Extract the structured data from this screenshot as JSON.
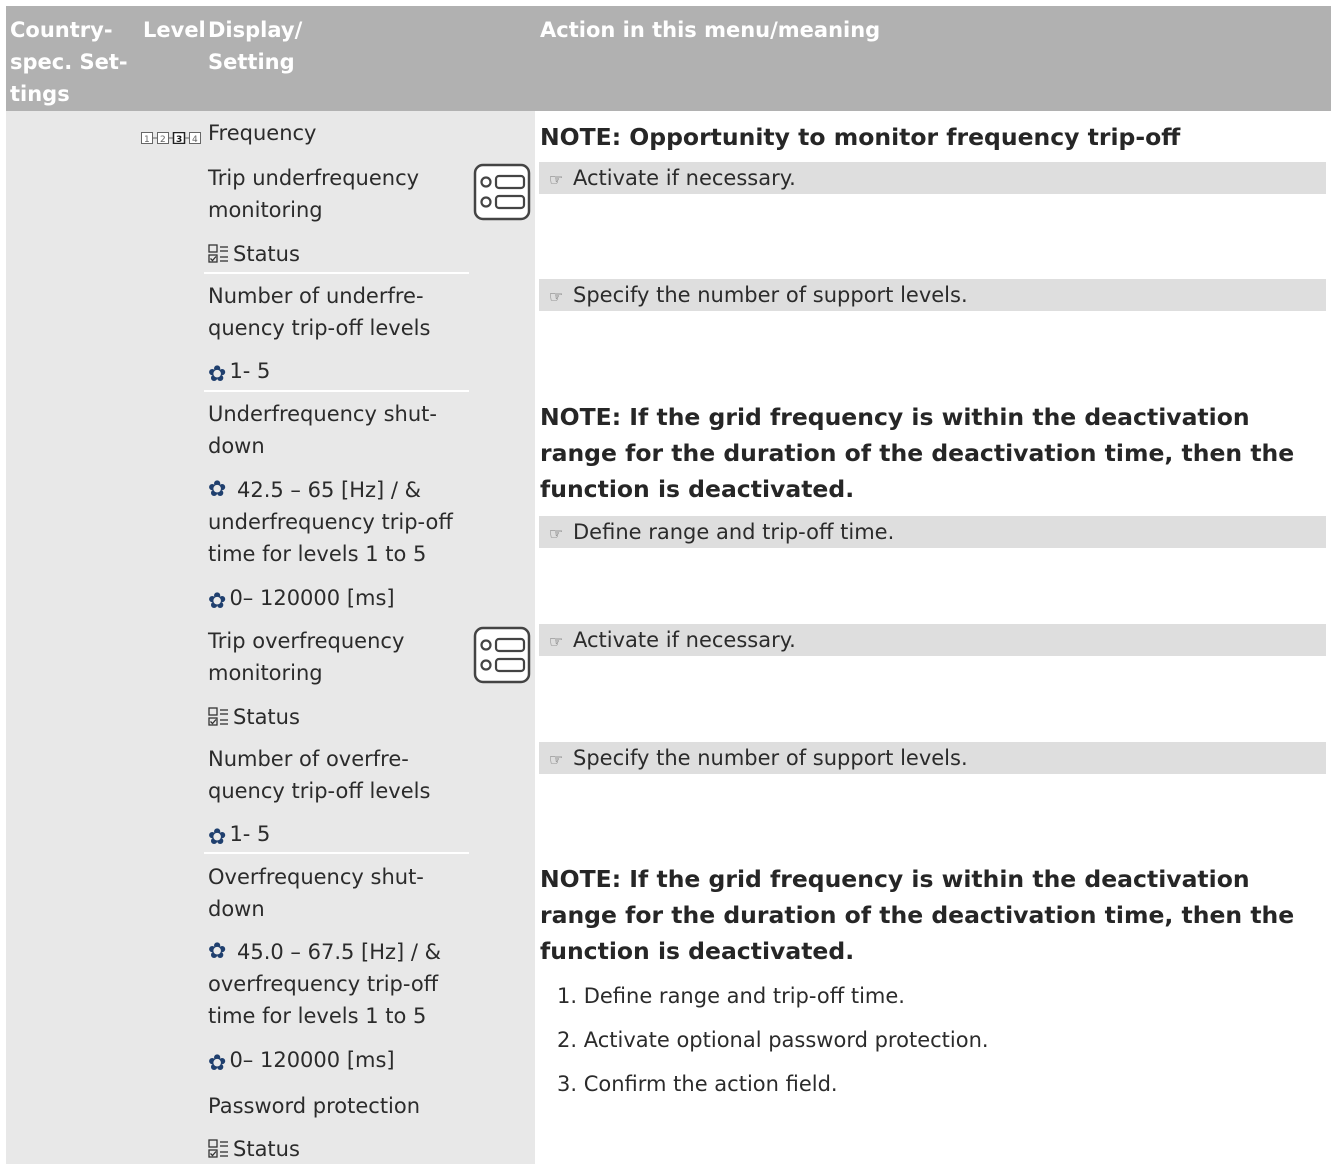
{
  "header": {
    "country": "Country-\nspec. Set-\ntings",
    "level": "Level",
    "display": "Display/\nSetting",
    "action": "Action in this menu/meaning"
  },
  "frequency": {
    "title": "Frequency",
    "note": "NOTE: Opportunity to monitor frequency trip-off"
  },
  "trip_under": {
    "label": "Trip underfrequency\nmonitoring",
    "setting": "Status",
    "action": "Activate if necessary."
  },
  "num_under": {
    "label": "Number of underfre-\nquency trip-off levels",
    "setting": "1- 5",
    "action": "Specify the number of support levels."
  },
  "under_shutdown": {
    "label": "Underfrequency shut-\ndown",
    "setting1": "42.5 – 65 [Hz] / &\nunderfrequency trip-off\ntime for levels 1 to 5",
    "setting2": "0– 120000 [ms]",
    "note": "NOTE: If the grid frequency is within the deactivation range for the duration of the deactivation time, then the function is deactivated.",
    "action": "Define range and trip-off time."
  },
  "trip_over": {
    "label": "Trip overfrequency\nmonitoring",
    "setting": "Status",
    "action": "Activate if necessary."
  },
  "num_over": {
    "label": "Number of overfre-\nquency trip-off levels",
    "setting": "1- 5",
    "action": "Specify the number of support levels."
  },
  "over_shutdown": {
    "label": "Overfrequency shut-\ndown",
    "setting1": "45.0 – 67.5 [Hz] / &\noverfrequency trip-off\ntime for levels 1 to 5",
    "setting2": "0– 120000 [ms]",
    "password_label": "Password protection",
    "password_setting": "Status",
    "note": "NOTE: If the grid frequency is within the deactivation range for the duration of the deactivation time, then the function is deactivated.",
    "steps": [
      "1. Define range and trip-off time.",
      "2. Activate optional password protection.",
      "3. Confirm the action field."
    ]
  },
  "icons": {
    "level": "level-indicator-icon",
    "status": "status-list-icon",
    "gear": "gear-icon",
    "hand": "pointing-hand-icon",
    "toggle": "toggle-setting-icon"
  },
  "colors": {
    "header_bg": "#b1b1b1",
    "body_bg": "#e8e8e8",
    "action_bar": "#dedede",
    "gear": "#1f3f6e"
  }
}
